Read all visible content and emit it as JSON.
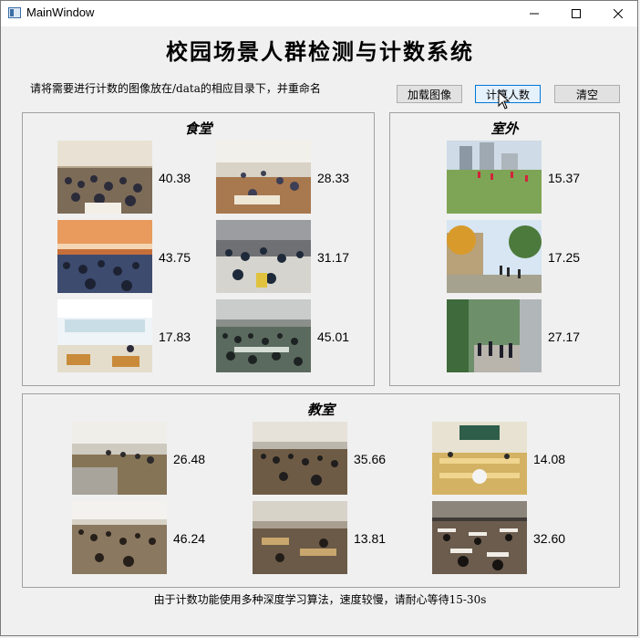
{
  "window": {
    "title": "MainWindow"
  },
  "header": {
    "title": "校园场景人群检测与计数系统",
    "hint": "请将需要进行计数的图像放在/data的相应目录下，并重命名"
  },
  "toolbar": {
    "load_label": "加载图像",
    "count_label": "计算人数",
    "clear_label": "清空"
  },
  "groups": {
    "canteen": {
      "title": "食堂",
      "counts": [
        "40.38",
        "28.33",
        "43.75",
        "31.17",
        "17.83",
        "45.01"
      ]
    },
    "outdoor": {
      "title": "室外",
      "counts": [
        "15.37",
        "17.25",
        "27.17"
      ]
    },
    "classroom": {
      "title": "教室",
      "counts": [
        "26.48",
        "35.66",
        "14.08",
        "46.24",
        "13.81",
        "32.60"
      ]
    }
  },
  "footer": {
    "note": "由于计数功能使用多种深度学习算法，速度较慢，请耐心等待15-30s"
  }
}
